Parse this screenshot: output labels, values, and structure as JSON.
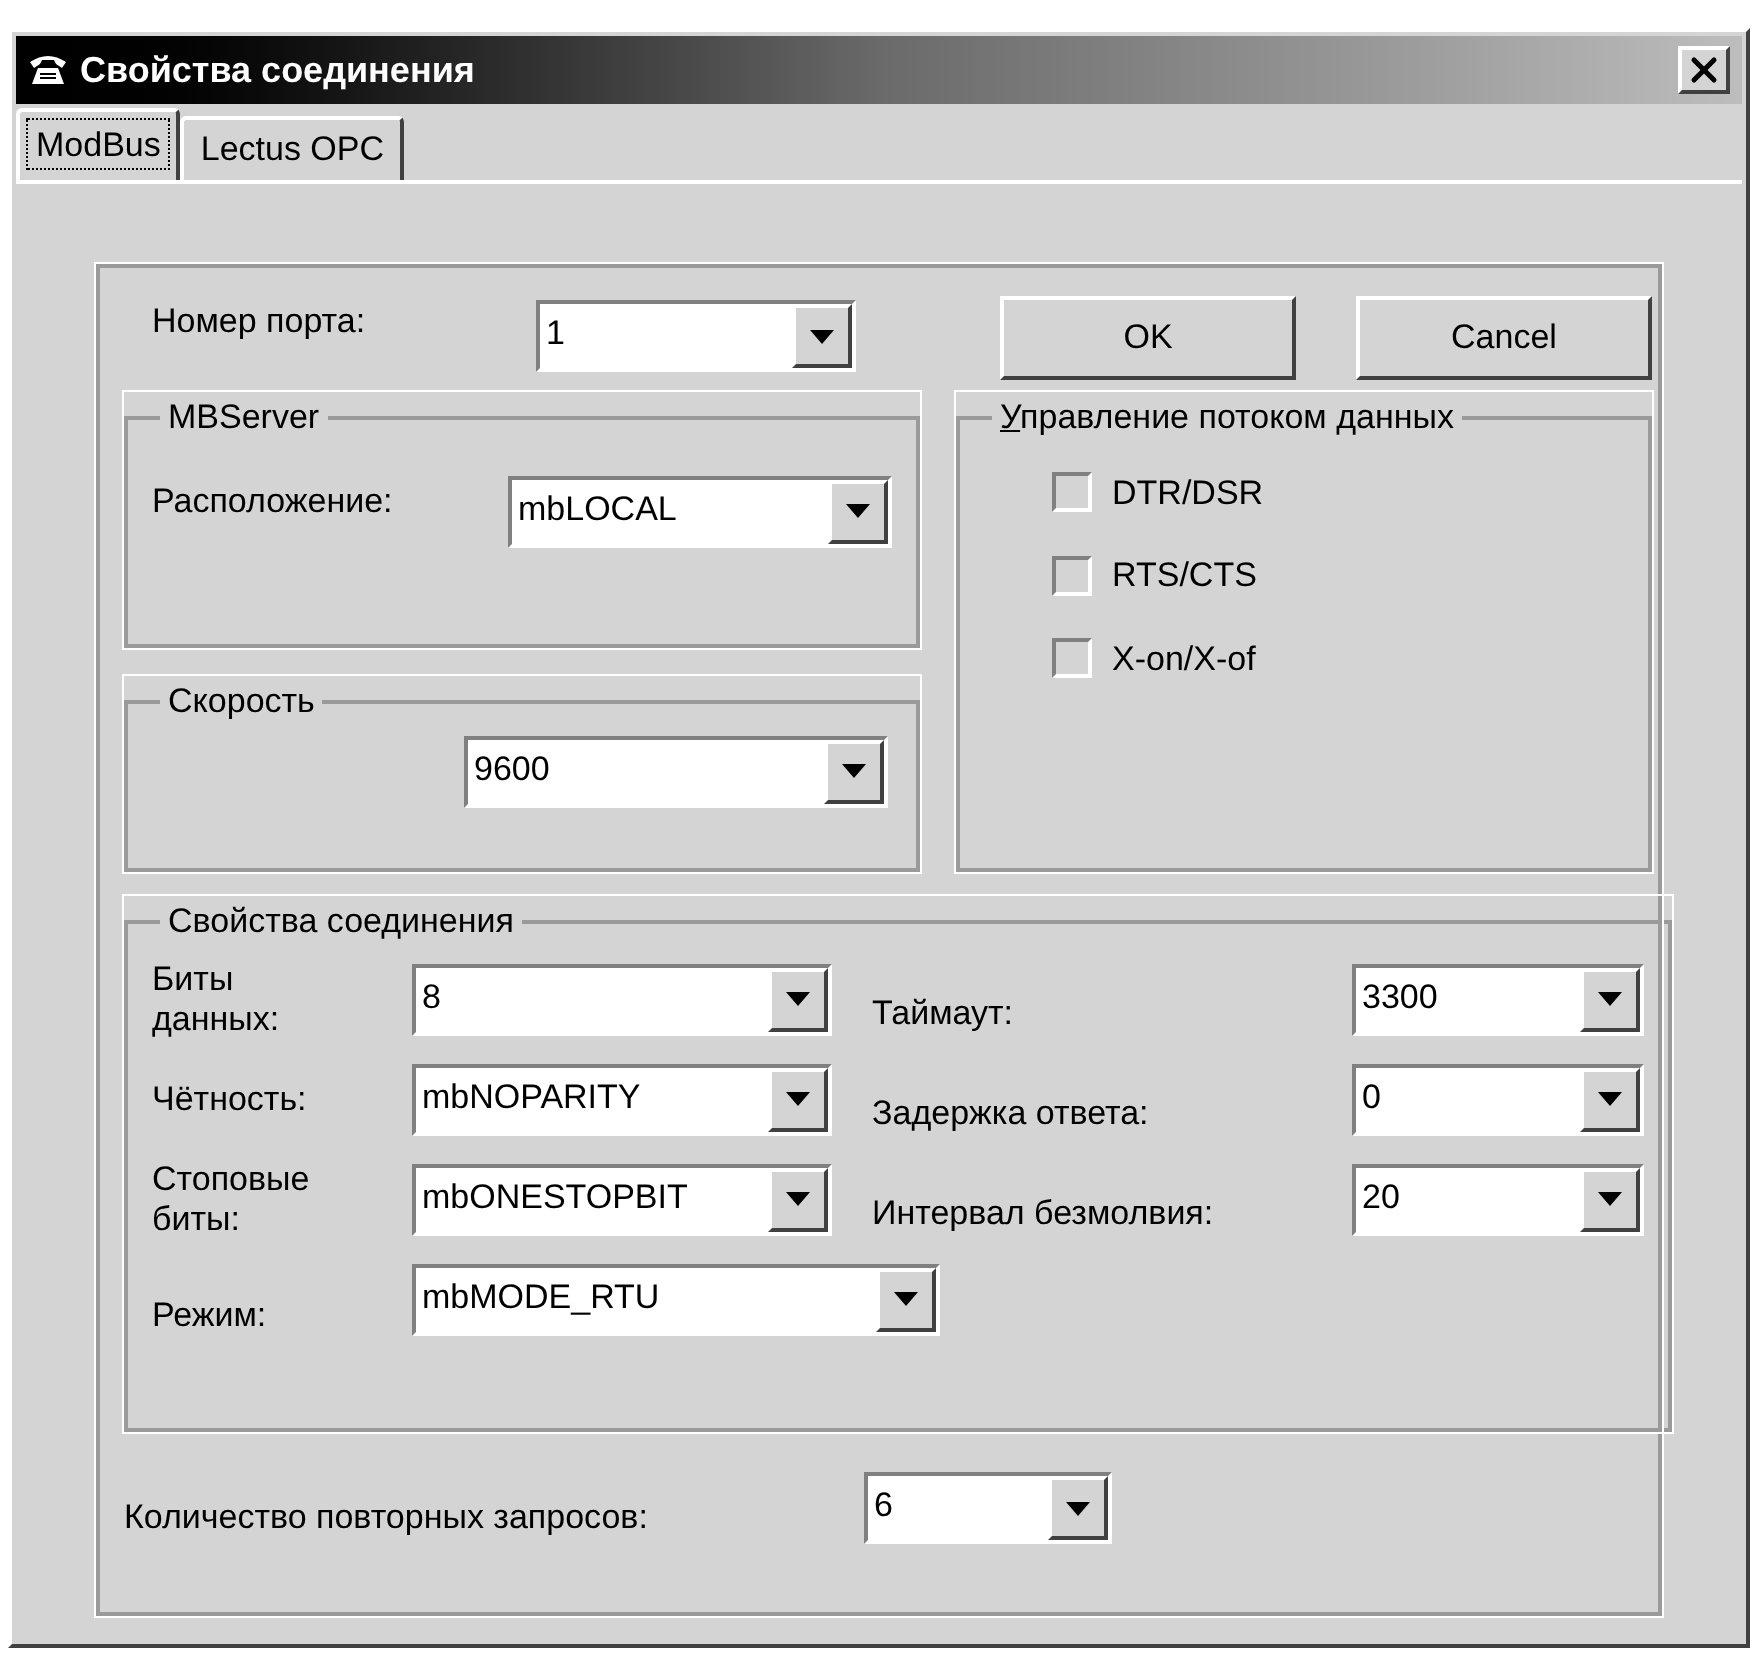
{
  "window": {
    "title": "Свойства соединения"
  },
  "tabs": [
    {
      "label": "ModBus",
      "selected": true
    },
    {
      "label": "Lectus OPC",
      "selected": false
    }
  ],
  "port": {
    "label": "Номер порта:",
    "value": "1"
  },
  "buttons": [
    "OK",
    "Cancel"
  ],
  "mbserver": {
    "title": "MBServer",
    "label": "Расположение:",
    "value": "mbLOCAL"
  },
  "speed": {
    "title": "Скорость",
    "value": "9600"
  },
  "flow_control": {
    "title": "Управление потоком данных",
    "options": [
      {
        "label": "DTR/DSR",
        "checked": false
      },
      {
        "label": "RTS/CTS",
        "checked": false
      },
      {
        "label": "X-on/X-of",
        "checked": false
      }
    ]
  },
  "connection": {
    "title": "Свойства соединения",
    "left": [
      {
        "label": "Биты данных:",
        "value": "8"
      },
      {
        "label": "Чётность:",
        "value": "mbNOPARITY"
      },
      {
        "label": "Стоповые биты:",
        "value": "mbONESTOPBIT"
      }
    ],
    "right": [
      {
        "label": "Таймаут:",
        "value": "3300"
      },
      {
        "label": "Задержка ответа:",
        "value": "0"
      },
      {
        "label": "Интервал безмолвия:",
        "value": "20"
      }
    ],
    "mode": {
      "label": "Режим:",
      "value": "mbMODE_RTU"
    }
  },
  "retries": {
    "label": "Количество повторных запросов:",
    "value": "6"
  }
}
